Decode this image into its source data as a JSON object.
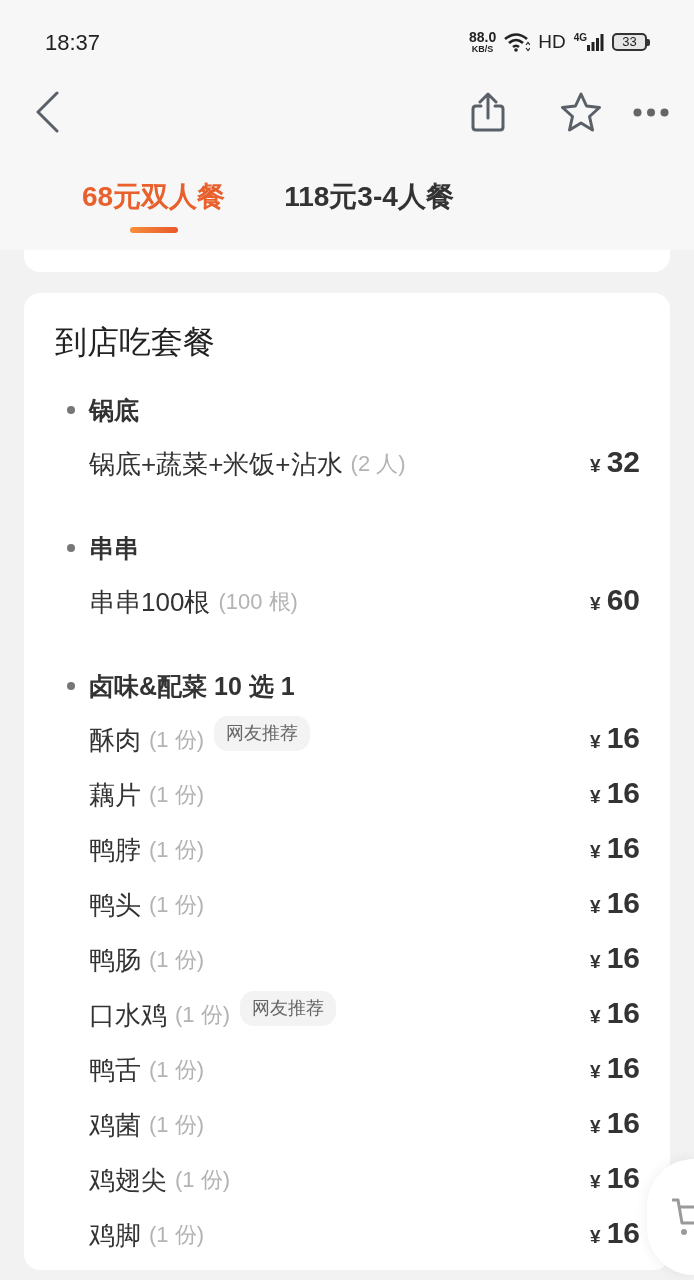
{
  "status_bar": {
    "time": "18:37",
    "speed": "88.0",
    "speed_unit": "KB/S",
    "hd": "HD",
    "network": "4G",
    "battery": "33"
  },
  "tabs": [
    {
      "label": "68元双人餐",
      "selected": true
    },
    {
      "label": "118元3-4人餐",
      "selected": false
    }
  ],
  "package": {
    "title": "到店吃套餐",
    "sections": [
      {
        "title": "锅底",
        "items": [
          {
            "name": "锅底+蔬菜+米饭+沾水",
            "quantity": "(2 人)",
            "currency": "¥",
            "price": "32"
          }
        ]
      },
      {
        "title": "串串",
        "items": [
          {
            "name": "串串100根",
            "quantity": "(100 根)",
            "currency": "¥",
            "price": "60"
          }
        ]
      },
      {
        "title": "卤味&配菜 10 选 1",
        "items": [
          {
            "name": "酥肉",
            "quantity": "(1 份)",
            "tag": "网友推荐",
            "currency": "¥",
            "price": "16"
          },
          {
            "name": "藕片",
            "quantity": "(1 份)",
            "currency": "¥",
            "price": "16"
          },
          {
            "name": "鸭脖",
            "quantity": "(1 份)",
            "currency": "¥",
            "price": "16"
          },
          {
            "name": "鸭头",
            "quantity": "(1 份)",
            "currency": "¥",
            "price": "16"
          },
          {
            "name": "鸭肠",
            "quantity": "(1 份)",
            "currency": "¥",
            "price": "16"
          },
          {
            "name": "口水鸡",
            "quantity": "(1 份)",
            "tag": "网友推荐",
            "currency": "¥",
            "price": "16"
          },
          {
            "name": "鸭舌",
            "quantity": "(1 份)",
            "currency": "¥",
            "price": "16"
          },
          {
            "name": "鸡菌",
            "quantity": "(1 份)",
            "currency": "¥",
            "price": "16"
          },
          {
            "name": "鸡翅尖",
            "quantity": "(1 份)",
            "currency": "¥",
            "price": "16"
          },
          {
            "name": "鸡脚",
            "quantity": "(1 份)",
            "currency": "¥",
            "price": "16"
          }
        ]
      }
    ]
  }
}
